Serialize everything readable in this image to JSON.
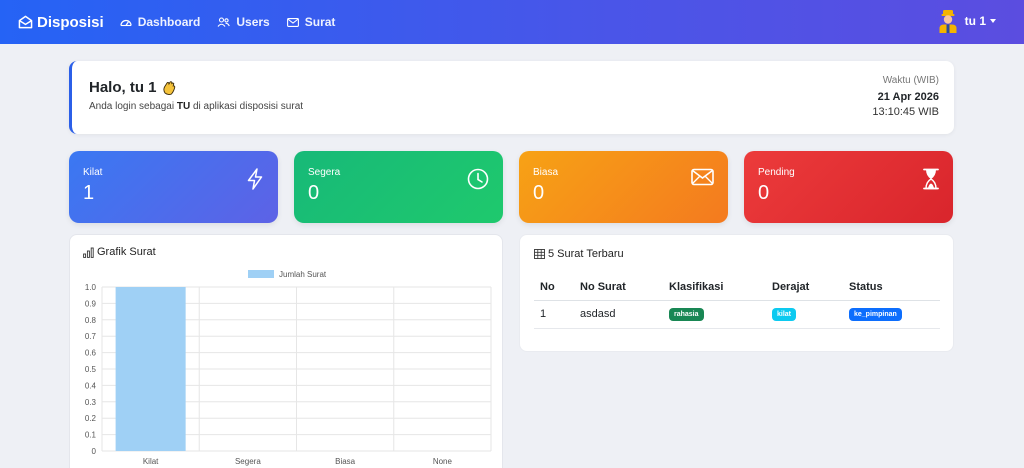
{
  "navbar": {
    "brand": "Disposisi",
    "links": [
      {
        "label": "Dashboard",
        "icon": "speedometer-icon"
      },
      {
        "label": "Users",
        "icon": "users-icon"
      },
      {
        "label": "Surat",
        "icon": "envelope-icon"
      }
    ],
    "user": "tu 1"
  },
  "greeting": {
    "title": "Halo, tu 1",
    "subtitle_prefix": "Anda login sebagai",
    "role": "TU",
    "subtitle_suffix": "di aplikasi disposisi surat",
    "time_label": "Waktu (WIB)",
    "date": "21 Apr 2026",
    "time": "13:10:45 WIB"
  },
  "stats": [
    {
      "label": "Kilat",
      "value": "1",
      "icon": "lightning-icon"
    },
    {
      "label": "Segera",
      "value": "0",
      "icon": "clock-icon"
    },
    {
      "label": "Biasa",
      "value": "0",
      "icon": "envelope-icon"
    },
    {
      "label": "Pending",
      "value": "0",
      "icon": "hourglass-icon"
    }
  ],
  "chart_card": {
    "title": "Grafik Surat"
  },
  "chart_data": {
    "type": "bar",
    "categories": [
      "Kilat",
      "Segera",
      "Biasa",
      "None"
    ],
    "series": [
      {
        "name": "Jumlah Surat",
        "values": [
          1,
          0,
          0,
          0
        ],
        "color": "#9fd0f5"
      }
    ],
    "ylim": [
      0,
      1.0
    ],
    "yticks": [
      "0",
      "0.1",
      "0.2",
      "0.3",
      "0.4",
      "0.5",
      "0.6",
      "0.7",
      "0.8",
      "0.9",
      "1.0"
    ],
    "legend": "top",
    "grid": true
  },
  "recent": {
    "title": "5 Surat Terbaru",
    "headers": [
      "No",
      "No Surat",
      "Klasifikasi",
      "Derajat",
      "Status"
    ],
    "rows": [
      {
        "no": "1",
        "no_surat": "asdasd",
        "klasifikasi": "rahasia",
        "derajat": "kilat",
        "status": "ke_pimpinan"
      }
    ],
    "badge_colors": {
      "klasifikasi": "#198754",
      "derajat": "#0dcaf0",
      "status": "#0d6efd"
    }
  }
}
